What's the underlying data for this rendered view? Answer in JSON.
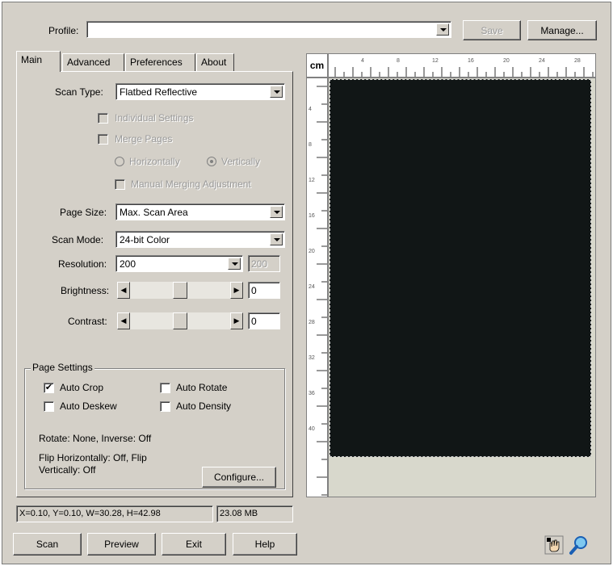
{
  "profile": {
    "label": "Profile:",
    "value": "",
    "save": "Save",
    "manage": "Manage..."
  },
  "tabs": [
    {
      "label": "Main"
    },
    {
      "label": "Advanced"
    },
    {
      "label": "Preferences"
    },
    {
      "label": "About"
    }
  ],
  "main": {
    "scan_type": {
      "label": "Scan Type:",
      "value": "Flatbed Reflective"
    },
    "individual_settings": "Individual Settings",
    "merge_pages": "Merge Pages",
    "horizontally": "Horizontally",
    "vertically": "Vertically",
    "manual_merging": "Manual Merging Adjustment",
    "page_size": {
      "label": "Page Size:",
      "value": "Max. Scan Area"
    },
    "scan_mode": {
      "label": "Scan Mode:",
      "value": "24-bit Color"
    },
    "resolution": {
      "label": "Resolution:",
      "value": "200",
      "field": "200"
    },
    "brightness": {
      "label": "Brightness:",
      "value": "0",
      "level": 0.5
    },
    "contrast": {
      "label": "Contrast:",
      "value": "0",
      "level": 0.5
    }
  },
  "page_settings": {
    "title": "Page Settings",
    "auto_crop": {
      "label": "Auto Crop",
      "checked": true
    },
    "auto_rotate": {
      "label": "Auto Rotate",
      "checked": false
    },
    "auto_deskew": {
      "label": "Auto Deskew",
      "checked": false
    },
    "auto_density": {
      "label": "Auto Density",
      "checked": false
    },
    "rotate_info": "Rotate: None, Inverse: Off",
    "flip_line1": "Flip Horizontally: Off, Flip",
    "flip_line2": "Vertically: Off",
    "configure": "Configure..."
  },
  "ruler": {
    "unit": "cm",
    "top_ticks": [
      "4",
      "8",
      "12",
      "16",
      "20",
      "24",
      "28"
    ],
    "left_ticks": [
      "4",
      "8",
      "12",
      "16",
      "20",
      "24",
      "28",
      "32",
      "36",
      "40"
    ]
  },
  "status": {
    "coords": "X=0.10, Y=0.10, W=30.28, H=42.98",
    "size": "23.08 MB"
  },
  "buttons": {
    "scan": "Scan",
    "preview": "Preview",
    "exit": "Exit",
    "help": "Help"
  },
  "colors": {
    "window": "#d4d0c8",
    "preview": "#111616"
  }
}
